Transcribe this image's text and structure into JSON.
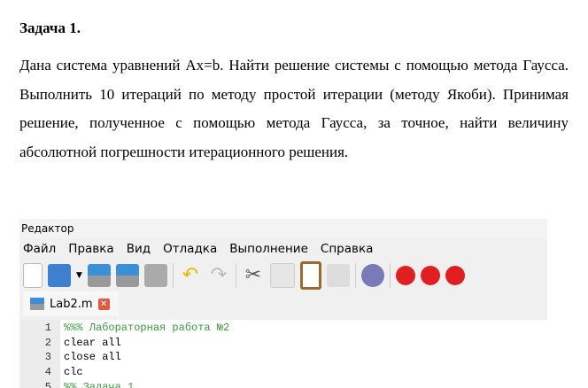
{
  "document": {
    "title": "Задача 1.",
    "paragraph": "Дана система уравнений Ax=b. Найти решение системы с помощью метода Гаусса. Выполнить 10 итераций по методу простой итерации (методу Якоби). Принимая решение, полученное с помощью метода Гаусса, за точное, найти величину абсолютной погрешности итерационного решения."
  },
  "editor": {
    "title": "Редактор",
    "menu": [
      "Файл",
      "Правка",
      "Вид",
      "Отладка",
      "Выполнение",
      "Справка"
    ],
    "tab": "Lab2.m",
    "lines": [
      {
        "n": "1",
        "text": "%%% Лабораторная работа №2",
        "comment": true
      },
      {
        "n": "2",
        "text": "clear all",
        "comment": false
      },
      {
        "n": "3",
        "text": "close all",
        "comment": false
      },
      {
        "n": "4",
        "text": "clc",
        "comment": false
      },
      {
        "n": "5",
        "text": "%% Задача 1",
        "comment": true
      }
    ]
  }
}
